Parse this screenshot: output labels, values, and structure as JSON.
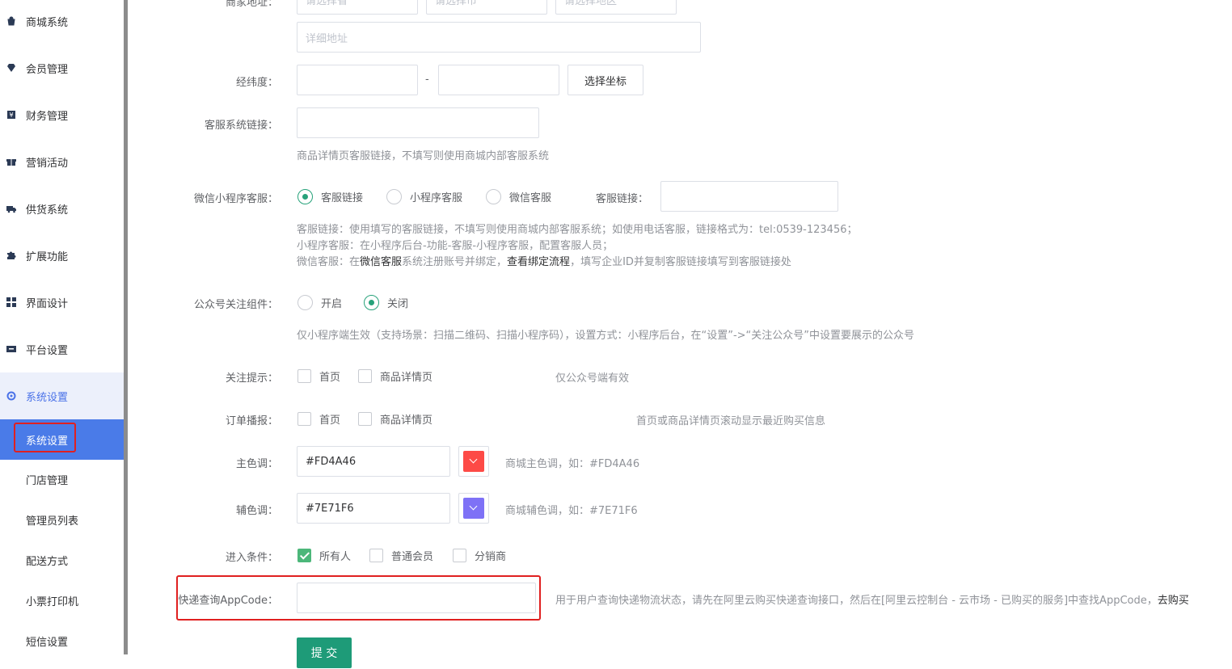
{
  "sidebar": {
    "items": [
      {
        "label": "商城系统",
        "icon": "bag-icon"
      },
      {
        "label": "会员管理",
        "icon": "diamond-icon"
      },
      {
        "label": "财务管理",
        "icon": "yen-icon"
      },
      {
        "label": "营销活动",
        "icon": "gift-icon"
      },
      {
        "label": "供货系统",
        "icon": "truck-icon"
      },
      {
        "label": "扩展功能",
        "icon": "puzzle-icon"
      },
      {
        "label": "界面设计",
        "icon": "layout-icon"
      },
      {
        "label": "平台设置",
        "icon": "monitor-icon"
      },
      {
        "label": "系统设置",
        "icon": "gear-icon"
      }
    ],
    "subitems": [
      {
        "label": "系统设置"
      },
      {
        "label": "门店管理"
      },
      {
        "label": "管理员列表"
      },
      {
        "label": "配送方式"
      },
      {
        "label": "小票打印机"
      },
      {
        "label": "短信设置"
      }
    ]
  },
  "form": {
    "address": {
      "label": "商家地址：",
      "province_placeholder": "请选择省",
      "city_placeholder": "请选择市",
      "district_placeholder": "请选择地区",
      "detail_placeholder": "详细地址"
    },
    "coords": {
      "label": "经纬度：",
      "separator": "-",
      "button": "选择坐标"
    },
    "service_link": {
      "label": "客服系统链接：",
      "hint": "商品详情页客服链接，不填写则使用商城内部客服系统"
    },
    "wechat_service": {
      "label": "微信小程序客服：",
      "options": [
        "客服链接",
        "小程序客服",
        "微信客服"
      ],
      "selected": "客服链接",
      "link_label": "客服链接：",
      "hint1": "客服链接：使用填写的客服链接，不填写则使用商城内部客服系统；如使用电话客服，链接格式为：tel:0539-123456；",
      "hint2": "小程序客服：在小程序后台-功能-客服-小程序客服，配置客服人员；",
      "hint3_a": "微信客服：在",
      "hint3_link1": "微信客服",
      "hint3_b": "系统注册账号并绑定，",
      "hint3_link2": "查看绑定流程",
      "hint3_c": "，填写企业ID并复制客服链接填写到客服链接处"
    },
    "official_account": {
      "label": "公众号关注组件：",
      "options": [
        "开启",
        "关闭"
      ],
      "selected": "关闭",
      "hint": "仅小程序端生效（支持场景：扫描二维码、扫描小程序码），设置方式：小程序后台，在“设置”->“关注公众号”中设置要展示的公众号"
    },
    "follow_tip": {
      "label": "关注提示：",
      "options": [
        "首页",
        "商品详情页"
      ],
      "hint": "仅公众号端有效"
    },
    "order_broadcast": {
      "label": "订单播报：",
      "options": [
        "首页",
        "商品详情页"
      ],
      "hint": "首页或商品详情页滚动显示最近购买信息"
    },
    "main_color": {
      "label": "主色调：",
      "value": "#FD4A46",
      "color": "#FD4A46",
      "hint": "商城主色调，如：#FD4A46"
    },
    "sub_color": {
      "label": "辅色调：",
      "value": "#7E71F6",
      "color": "#7E71F6",
      "hint": "商城辅色调，如：#7E71F6"
    },
    "entry": {
      "label": "进入条件：",
      "options": [
        "所有人",
        "普通会员",
        "分销商"
      ],
      "checked": "所有人"
    },
    "appcode": {
      "label": "快递查询AppCode：",
      "value": "",
      "hint": "用于用户查询快递物流状态，请先在阿里云购买快递查询接口，然后在[阿里云控制台 - 云市场 - 已购买的服务]中查找AppCode，",
      "hint_link": "去购买"
    },
    "submit": "提 交"
  },
  "colors": {
    "accent": "#1e9b78",
    "active_menu": "#4a7be8",
    "highlight_border": "#e02020"
  }
}
